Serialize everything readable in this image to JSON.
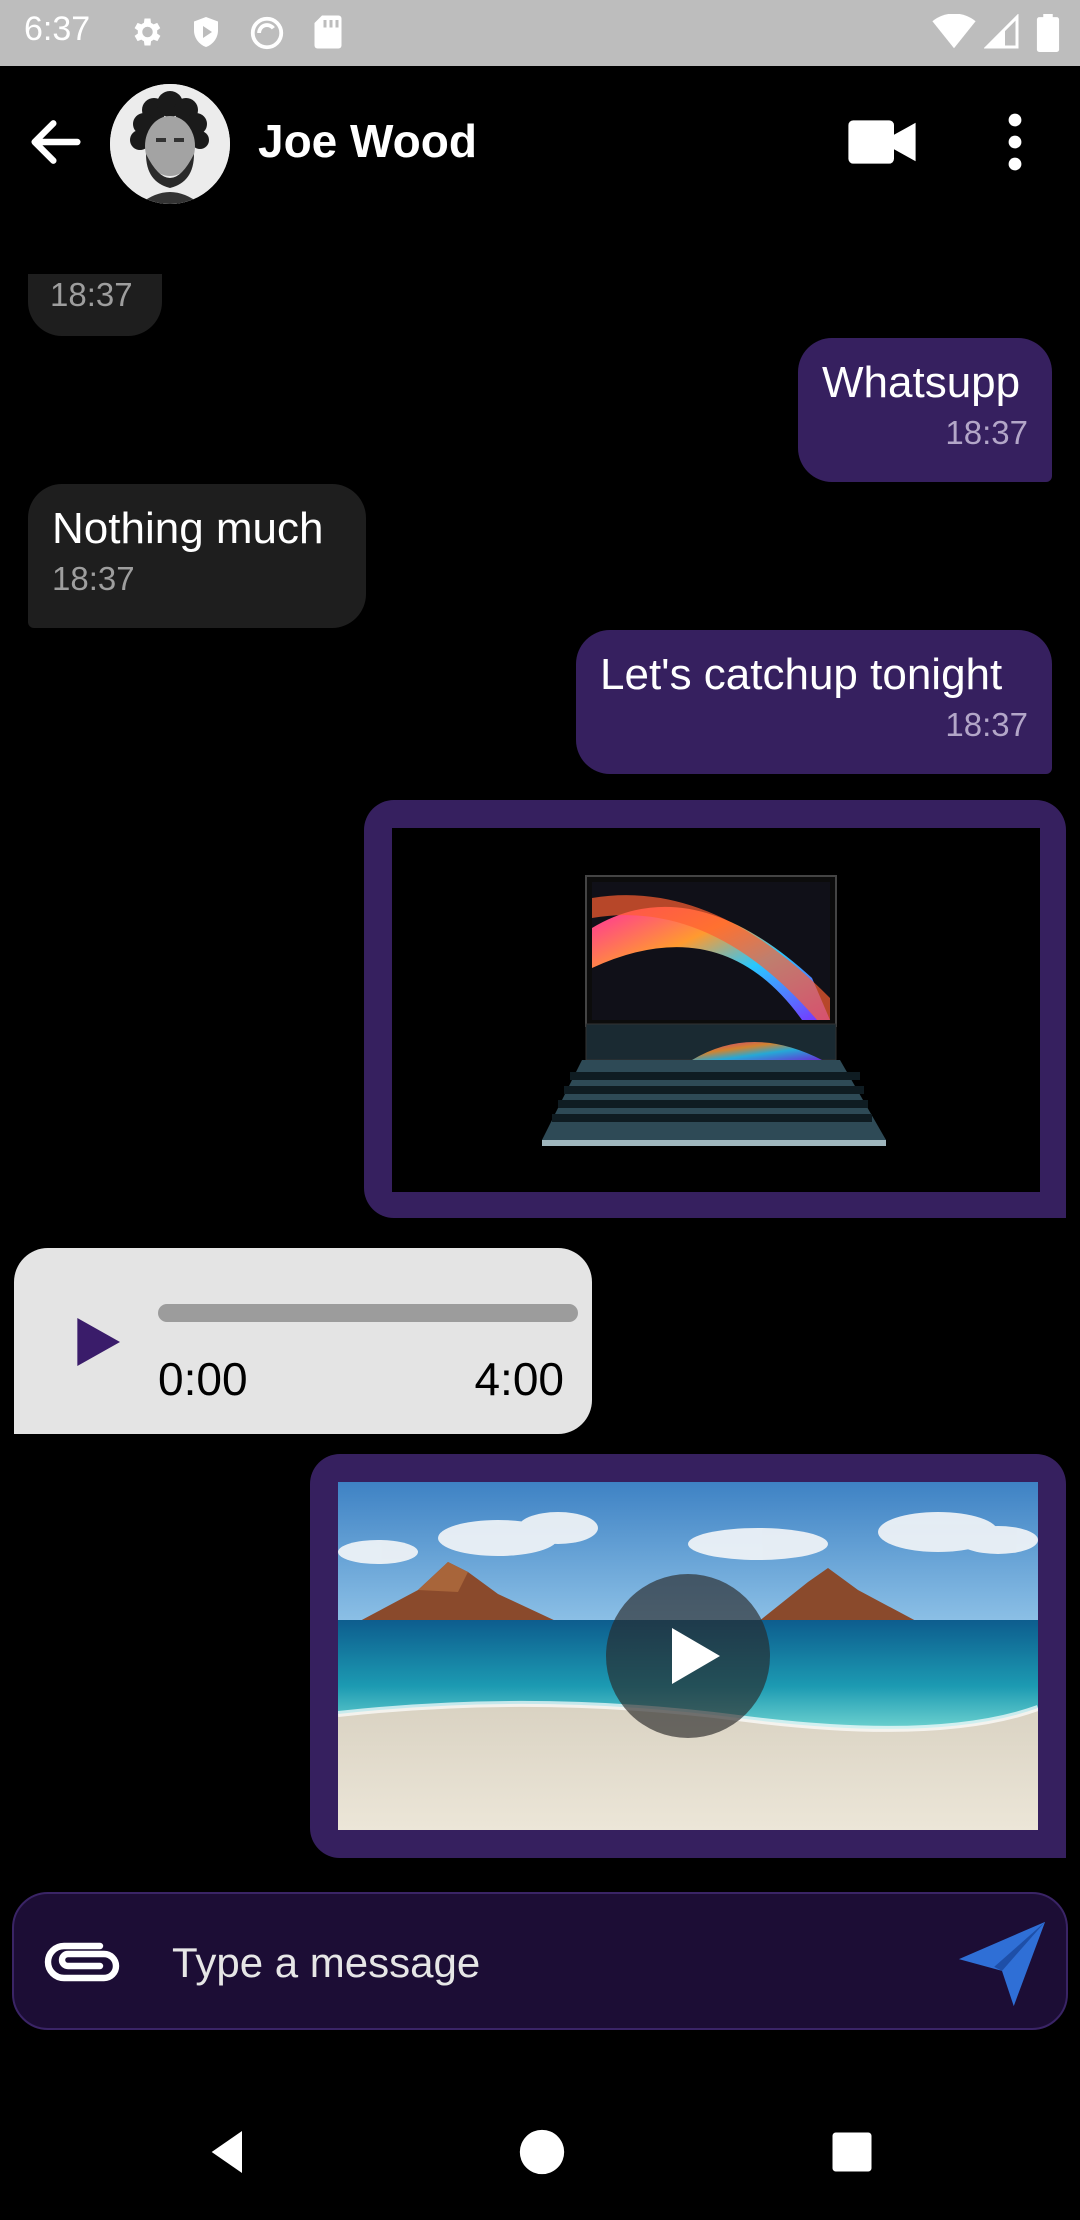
{
  "status_bar": {
    "time": "6:37",
    "icons": [
      "gear-icon",
      "shield-icon",
      "sync-icon",
      "sd-card-icon",
      "wifi-icon",
      "signal-icon",
      "battery-icon"
    ]
  },
  "header": {
    "contact_name": "Joe Wood",
    "icons": [
      "back-arrow-icon",
      "avatar",
      "video-camera-icon",
      "more-vert-icon"
    ]
  },
  "messages": [
    {
      "direction": "incoming",
      "text": "",
      "time": "18:37"
    },
    {
      "direction": "outgoing",
      "text": "Whatsupp",
      "time": "18:37"
    },
    {
      "direction": "incoming",
      "text": "Nothing much",
      "time": "18:37"
    },
    {
      "direction": "outgoing",
      "text": "Let's catchup tonight",
      "time": "18:37"
    },
    {
      "direction": "outgoing",
      "type": "image",
      "content": "laptop-image"
    },
    {
      "direction": "incoming",
      "type": "audio",
      "current_time": "0:00",
      "duration": "4:00",
      "progress": 0
    },
    {
      "direction": "outgoing",
      "type": "video",
      "content": "beach-video-thumbnail"
    }
  ],
  "composer": {
    "placeholder": "Type a message",
    "value": "",
    "icons": [
      "attachment-icon",
      "send-icon"
    ]
  },
  "colors": {
    "background": "#000000",
    "outgoing_bubble": "#36205f",
    "incoming_bubble": "#1e1e1e",
    "audio_bubble": "#e4e4e4",
    "composer_bg": "#1c0d35",
    "send_icon": "#2f6fd6",
    "status_bar": "#bdbdbd"
  },
  "nav_bar": {
    "icons": [
      "nav-back-icon",
      "nav-home-icon",
      "nav-recents-icon"
    ]
  }
}
